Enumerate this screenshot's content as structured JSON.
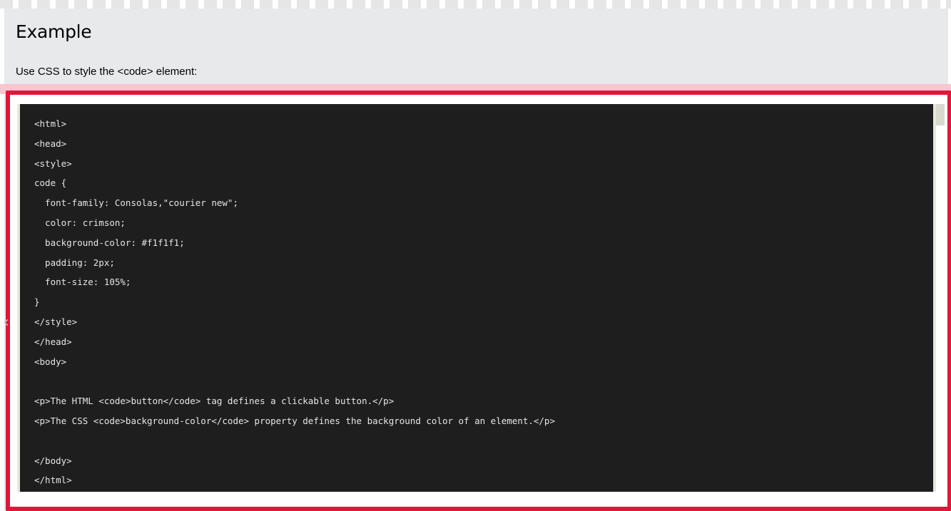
{
  "example": {
    "title": "Example",
    "intro": "Use CSS to style the <code> element:"
  },
  "code": {
    "lines": [
      "<html>",
      "<head>",
      "<style>",
      "code {",
      "  font-family: Consolas,\"courier new\";",
      "  color: crimson;",
      "  background-color: #f1f1f1;",
      "  padding: 2px;",
      "  font-size: 105%;",
      "}",
      "</style>",
      "</head>",
      "<body>",
      "",
      "<p>The HTML <code>button</code> tag defines a clickable button.</p>",
      "<p>The CSS <code>background-color</code> property defines the background color of an element.</p>",
      "",
      "</body>",
      "</html>"
    ]
  },
  "colors": {
    "panel_bg": "#e7e9eb",
    "highlight_red": "#e0163a",
    "code_bg": "#1e1e1e"
  },
  "icons": {
    "left_tab": "chevron-left-icon"
  }
}
